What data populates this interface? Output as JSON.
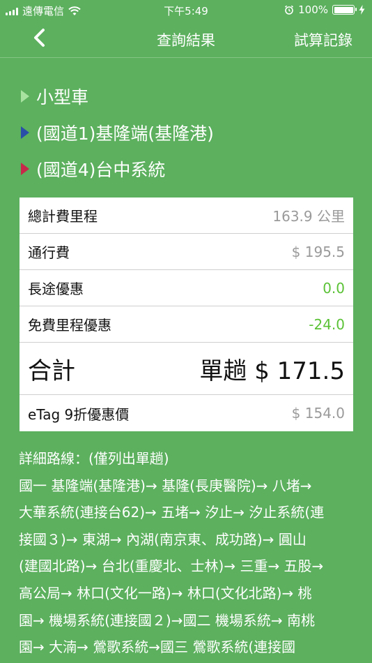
{
  "status_bar": {
    "carrier": "遠傳電信",
    "time": "下午5:49",
    "battery": "100%"
  },
  "nav": {
    "title": "查詢結果",
    "record": "試算記錄"
  },
  "summary": {
    "vehicle": "小型車",
    "start": "(國道1)基隆端(基隆港)",
    "end": "(國道4)台中系統",
    "colors": {
      "vehicle": "#a8e2a0",
      "start": "#2a4fa8",
      "end": "#c8284a"
    }
  },
  "fees": {
    "mileage_label": "總計費里程",
    "mileage_value": "163.9 公里",
    "toll_label": "通行費",
    "toll_value": "$ 195.5",
    "long_label": "長途優惠",
    "long_value": "0.0",
    "free_label": "免費里程優惠",
    "free_value": "-24.0",
    "total_label": "合計",
    "total_value": "單趟 $ 171.5",
    "etag_label": "eTag 9折優惠價",
    "etag_value": "$ 154.0"
  },
  "details": {
    "heading": "詳細路線：(僅列出單趟)",
    "lines": [
      "國一 基隆端(基隆港)→ 基隆(長庚醫院)→ 八堵→",
      "大華系統(連接台62)→ 五堵→ 汐止→ 汐止系統(連",
      "接國３)→ 東湖→ 內湖(南京東、成功路)→ 圓山",
      "(建國北路)→ 台北(重慶北、士林)→ 三重→ 五股→",
      "高公局→ 林口(文化一路)→ 林口(文化北路)→ 桃",
      "園→ 機場系統(連接國２)→國二 機場系統→ 南桃",
      "園→ 大湳→ 鶯歌系統→國三 鶯歌系統(連接國"
    ]
  },
  "theme": {
    "background": "#5cb05e",
    "positive": "#5bc236"
  }
}
